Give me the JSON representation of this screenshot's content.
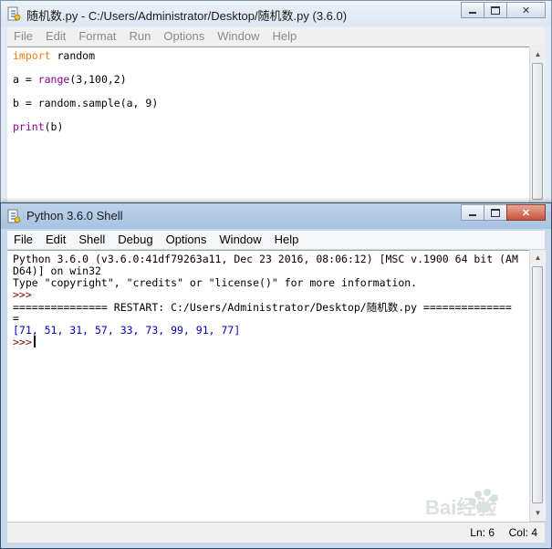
{
  "editor": {
    "title": "随机数.py - C:/Users/Administrator/Desktop/随机数.py (3.6.0)",
    "menu": [
      "File",
      "Edit",
      "Format",
      "Run",
      "Options",
      "Window",
      "Help"
    ],
    "code": {
      "line1_kw": "import",
      "line1_rest": " random",
      "line2_a": "a = ",
      "line2_fn": "range",
      "line2_args": "(3,100,2)",
      "line3": "b = random.sample(a, 9)",
      "line4_fn": "print",
      "line4_args": "(b)"
    }
  },
  "shell": {
    "title": "Python 3.6.0 Shell",
    "menu": [
      "File",
      "Edit",
      "Shell",
      "Debug",
      "Options",
      "Window",
      "Help"
    ],
    "lines": {
      "banner1": "Python 3.6.0 (v3.6.0:41df79263a11, Dec 23 2016, 08:06:12) [MSC v.1900 64 bit (AM",
      "banner2": "D64)] on win32",
      "banner3": "Type \"copyright\", \"credits\" or \"license()\" for more information.",
      "prompt": ">>>",
      "restart1": "=============== RESTART: C:/Users/Administrator/Desktop/随机数.py ==============",
      "restart2": "=",
      "output": "[71, 51, 31, 57, 33, 73, 99, 91, 77]"
    },
    "status": {
      "ln": "Ln: 6",
      "col": "Col: 4"
    }
  },
  "watermark_text": "Bai经验"
}
